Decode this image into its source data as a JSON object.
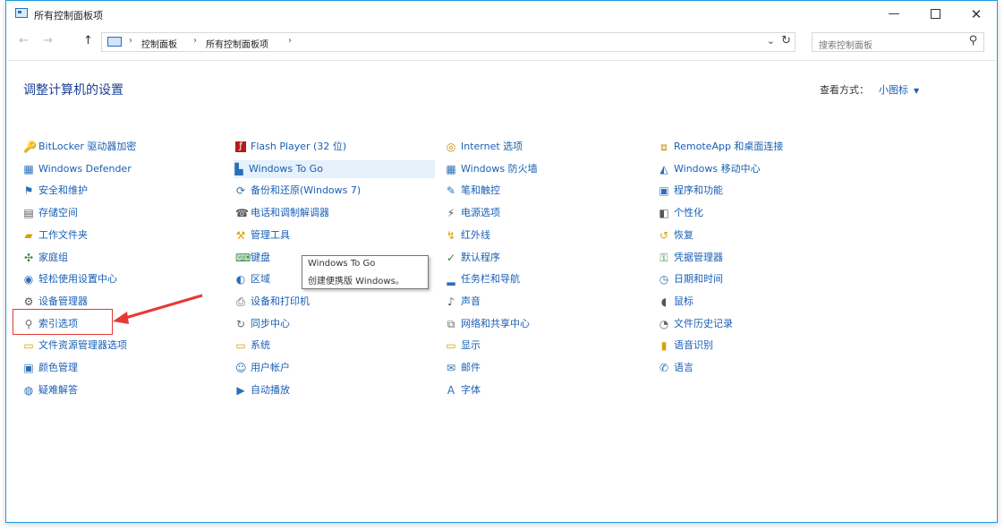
{
  "window": {
    "title": "所有控制面板项"
  },
  "address": {
    "crumbs": [
      "控制面板",
      "所有控制面板项"
    ],
    "search_placeholder": "搜索控制面板"
  },
  "header": {
    "heading": "调整计算机的设置",
    "view_by_label": "查看方式：",
    "view_by_value": "小图标"
  },
  "columns": [
    [
      {
        "label": "BitLocker 驱动器加密",
        "icon": "bitlocker-icon"
      },
      {
        "label": "Windows Defender",
        "icon": "defender-icon"
      },
      {
        "label": "安全和维护",
        "icon": "flag-icon"
      },
      {
        "label": "存储空间",
        "icon": "storage-icon"
      },
      {
        "label": "工作文件夹",
        "icon": "folder-icon"
      },
      {
        "label": "家庭组",
        "icon": "homegroup-icon"
      },
      {
        "label": "轻松使用设置中心",
        "icon": "ease-of-access-icon"
      },
      {
        "label": "设备管理器",
        "icon": "device-manager-icon"
      },
      {
        "label": "索引选项",
        "icon": "indexing-icon"
      },
      {
        "label": "文件资源管理器选项",
        "icon": "folder-options-icon"
      },
      {
        "label": "颜色管理",
        "icon": "color-management-icon"
      },
      {
        "label": "疑难解答",
        "icon": "troubleshoot-icon"
      }
    ],
    [
      {
        "label": "Flash Player (32 位)",
        "icon": "flash-icon"
      },
      {
        "label": "Windows To Go",
        "icon": "windows-to-go-icon"
      },
      {
        "label": "备份和还原(Windows 7)",
        "icon": "backup-icon"
      },
      {
        "label": "电话和调制解调器",
        "icon": "phone-icon"
      },
      {
        "label": "管理工具",
        "icon": "admin-tools-icon"
      },
      {
        "label": "键盘",
        "icon": "keyboard-icon"
      },
      {
        "label": "区域",
        "icon": "region-icon"
      },
      {
        "label": "设备和打印机",
        "icon": "printer-icon"
      },
      {
        "label": "同步中心",
        "icon": "sync-icon"
      },
      {
        "label": "系统",
        "icon": "system-icon"
      },
      {
        "label": "用户帐户",
        "icon": "users-icon"
      },
      {
        "label": "自动播放",
        "icon": "autoplay-icon"
      }
    ],
    [
      {
        "label": "Internet 选项",
        "icon": "internet-icon"
      },
      {
        "label": "Windows 防火墙",
        "icon": "firewall-icon"
      },
      {
        "label": "笔和触控",
        "icon": "pen-icon"
      },
      {
        "label": "电源选项",
        "icon": "power-icon"
      },
      {
        "label": "红外线",
        "icon": "infrared-icon"
      },
      {
        "label": "默认程序",
        "icon": "default-programs-icon"
      },
      {
        "label": "任务栏和导航",
        "icon": "taskbar-icon"
      },
      {
        "label": "声音",
        "icon": "sound-icon"
      },
      {
        "label": "网络和共享中心",
        "icon": "network-icon"
      },
      {
        "label": "显示",
        "icon": "display-icon"
      },
      {
        "label": "邮件",
        "icon": "mail-icon"
      },
      {
        "label": "字体",
        "icon": "fonts-icon"
      }
    ],
    [
      {
        "label": "RemoteApp 和桌面连接",
        "icon": "remoteapp-icon"
      },
      {
        "label": "Windows 移动中心",
        "icon": "mobility-icon"
      },
      {
        "label": "程序和功能",
        "icon": "programs-icon"
      },
      {
        "label": "个性化",
        "icon": "personalization-icon"
      },
      {
        "label": "恢复",
        "icon": "recovery-icon"
      },
      {
        "label": "凭据管理器",
        "icon": "credential-icon"
      },
      {
        "label": "日期和时间",
        "icon": "datetime-icon"
      },
      {
        "label": "鼠标",
        "icon": "mouse-icon"
      },
      {
        "label": "文件历史记录",
        "icon": "file-history-icon"
      },
      {
        "label": "语音识别",
        "icon": "speech-icon"
      },
      {
        "label": "语言",
        "icon": "language-icon"
      }
    ]
  ],
  "tooltip": {
    "line1": "Windows To Go",
    "line2": "创建便携版 Windows。"
  },
  "colors": {
    "link": "#1a5fb4",
    "heading": "#1c3f94",
    "annotation": "#e53935",
    "hover": "#e5f1fb"
  }
}
